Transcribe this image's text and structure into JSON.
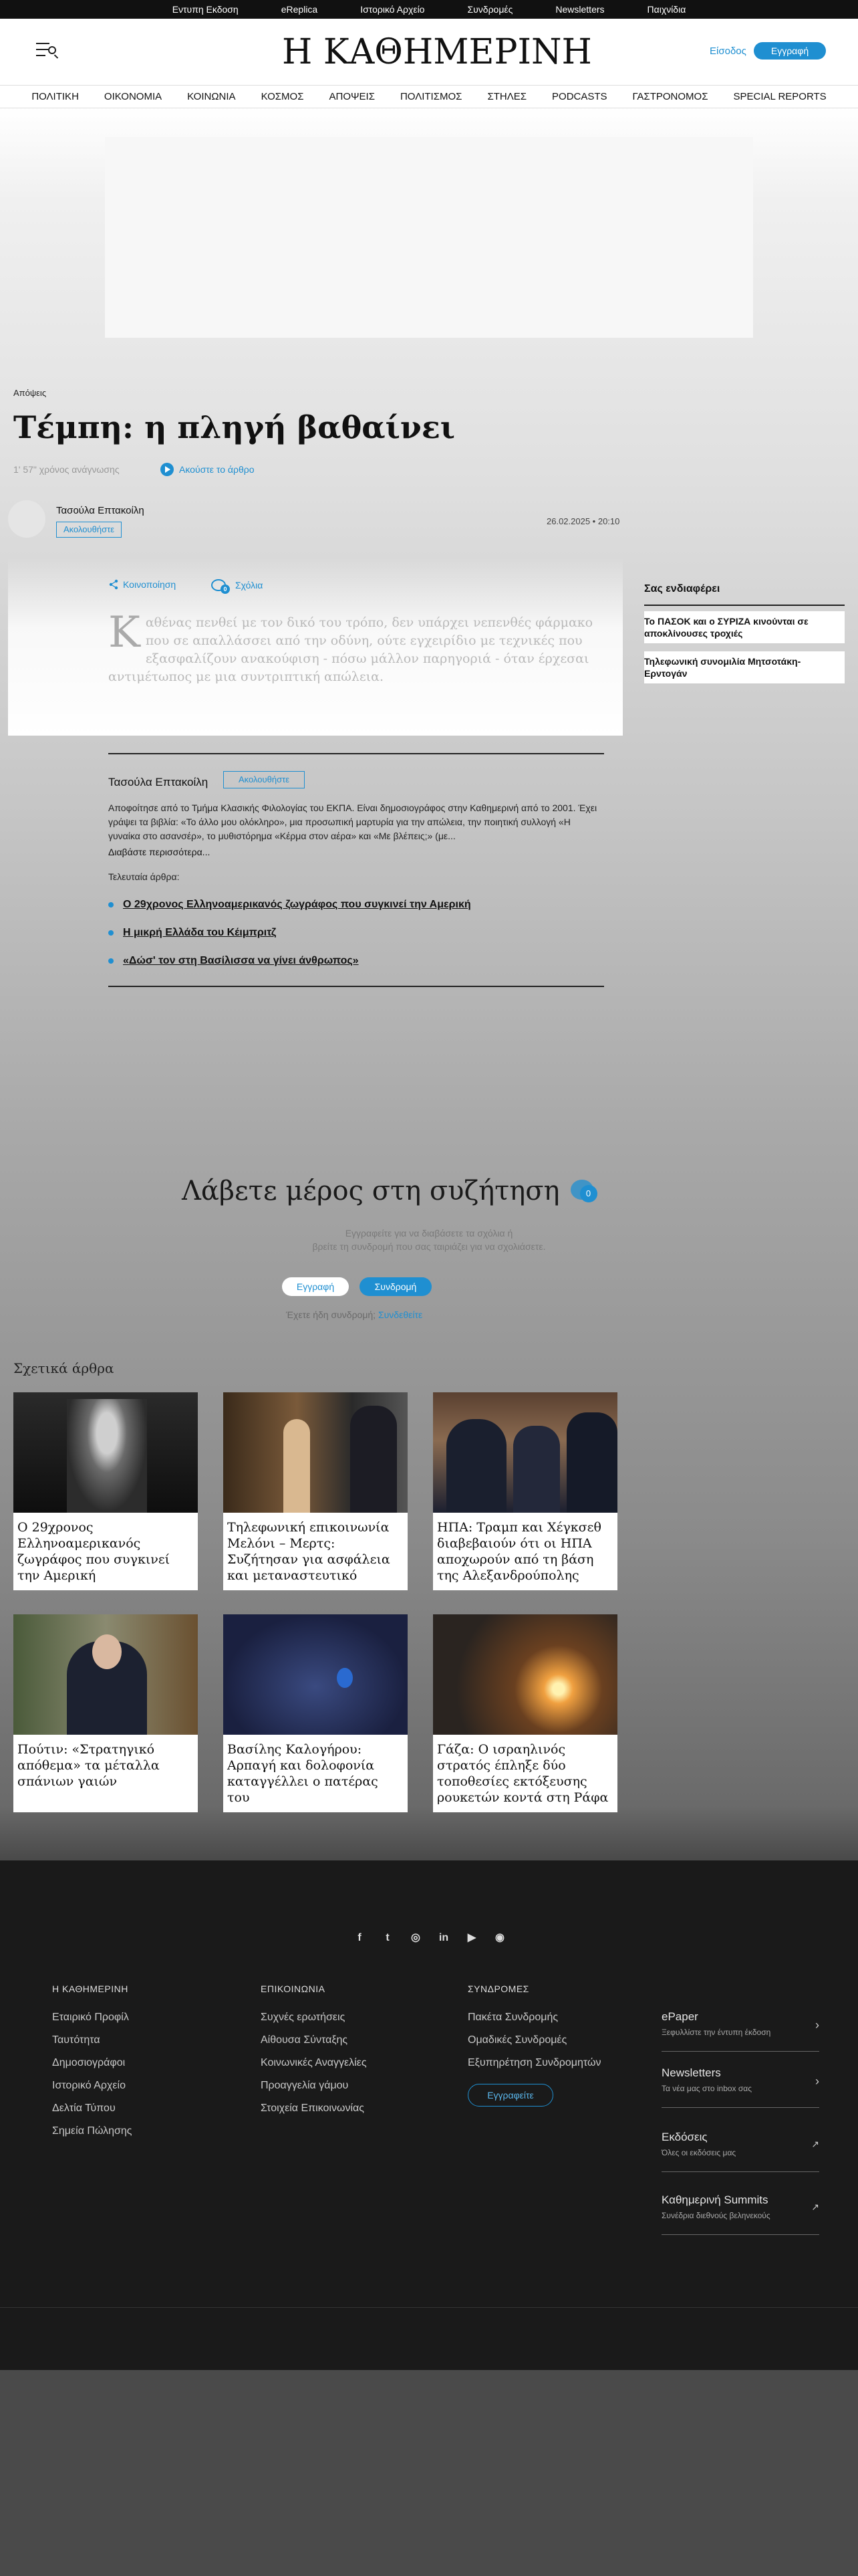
{
  "topbar": [
    "Εντυπη Εκδοση",
    "eReplica",
    "Ιστορικό Αρχείο",
    "Συνδρομές",
    "Newsletters",
    "Παιχνίδια"
  ],
  "header": {
    "logo_text": "Η ΚΑΘΗΜΕΡΙΝΗ",
    "login": "Είσοδος",
    "register": "Εγγραφή",
    "menu_icon": "menu-search-icon",
    "accent": "#1f8fd1"
  },
  "nav": [
    "ΠΟΛΙΤΙΚΗ",
    "ΟΙΚΟΝΟΜΙΑ",
    "ΚΟΙΝΩΝΙΑ",
    "ΚΟΣΜΟΣ",
    "ΑΠΟΨΕΙΣ",
    "ΠΟΛΙΤΙΣΜΟΣ",
    "ΣΤΗΛΕΣ",
    "PODCASTS",
    "ΓΑΣΤΡΟΝΟΜΟΣ",
    "SPECIAL REPORTS"
  ],
  "article": {
    "section": "Απόψεις",
    "title": "Τέμπη: η πληγή βαθαίνει",
    "read_time": "1' 57\" χρόνος ανάγνωσης",
    "listen": "Ακούστε το άρθρο",
    "author": "Τασούλα Επτακοίλη",
    "follow": "Ακολουθήστε",
    "date": "26.02.2025 • 20:10",
    "share": "Κοινοποίηση",
    "comments": "Σχόλια",
    "comment_count": "0",
    "dropcap": "Κ",
    "lead": "αθένας πενθεί με τον δικό του τρόπο, δεν υπάρχει νεπενθές φάρμακο που σε απαλλάσσει από την οδύνη, ούτε εγχειρίδιο με τεχνικές που εξασφαλίζουν ανακούφιση - πόσω μάλλον παρηγοριά - όταν έρχεσαι αντιμέτωπος με μια συντριπτική απώλεια."
  },
  "sidebar": {
    "title": "Σας ενδιαφέρει",
    "items": [
      "Το ΠΑΣΟΚ και ο ΣΥΡΙΖΑ κινούνται σε αποκλίνουσες τροχιές",
      "Τηλεφωνική συνομιλία Μητσοτάκη- Ερντογάν"
    ]
  },
  "author_box": {
    "name": "Τασούλα Επτακοίλη",
    "follow": "Ακολουθήστε",
    "bio": "Αποφοίτησε από το Τμήμα Κλασικής Φιλολογίας του ΕΚΠΑ. Είναι δημοσιογράφος στην Καθημερινή από το 2001. Έχει γράψει τα βιβλία: «Το άλλο μου ολόκληρο», μια προσωπική μαρτυρία για την απώλεια, την ποιητική συλλογή «Η γυναίκα στο ασανσέρ», το μυθιστόρημα «Κέρμα στον αέρα» και «Με βλέπεις;» (με...",
    "more": "Διαβάστε περισσότερα...",
    "latest_label": "Τελευταία άρθρα:",
    "latest": [
      "Ο 29χρονος Ελληνοαμερικανός ζωγράφος που συγκινεί την Αμερική",
      "Η μικρή Ελλάδα του Κέιμπριτζ",
      "«Δώσ' τον στη Βασίλισσα να γίνει άνθρωπος»"
    ]
  },
  "discussion": {
    "title": "Λάβετε μέρος στη συζήτηση",
    "count": "0",
    "line1": "Εγγραφείτε για να διαβάσετε τα σχόλια ή",
    "line2": "βρείτε τη συνδρομή που σας ταιριάζει για να σχολιάσετε.",
    "register": "Εγγραφή",
    "subscribe": "Συνδρομή",
    "have_sub": "Έχετε ήδη συνδρομή;",
    "login": "Συνδεθείτε"
  },
  "related": {
    "title": "Σχετικά άρθρα",
    "cards": [
      "Ο 29χρονος Ελληνοαμερικανός ζωγράφος που συγκινεί την Αμερική",
      "Τηλεφωνική επικοινωνία Μελόνι – Μερτς: Συζήτησαν για ασφάλεια και μεταναστευτικό",
      "ΗΠΑ: Τραμπ και Χέγκσεθ διαβεβαιούν ότι οι ΗΠΑ αποχωρούν από τη βάση της Αλεξανδρούπολης",
      "Πούτιν: «Στρατηγικό απόθεμα» τα μέταλλα σπάνιων γαιών",
      "Βασίλης Καλογήρου: Αρπαγή και δολοφονία καταγγέλλει ο πατέρας του",
      "Γάζα: Ο ισραηλινός στρατός έπληξε δύο τοποθεσίες εκτόξευσης ρουκετών κοντά στη Ράφα"
    ]
  },
  "footer": {
    "socials": [
      "f",
      "t",
      "◎",
      "in",
      "▶",
      "◉"
    ],
    "col1_title": "Η ΚΑΘΗΜΕΡΙΝΗ",
    "col1": [
      "Εταιρικό Προφίλ",
      "Ταυτότητα",
      "Δημοσιογράφοι",
      "Ιστορικό Αρχείο",
      "Δελτία Τύπου",
      "Σημεία Πώλησης"
    ],
    "col2_title": "ΕΠΙΚΟΙΝΩΝΙΑ",
    "col2": [
      "Συχνές ερωτήσεις",
      "Αίθουσα Σύνταξης",
      "Κοινωνικές Αναγγελίες",
      "Προαγγελία γάμου",
      "Στοιχεία Επικοινωνίας"
    ],
    "col3_title": "ΣΥΝΔΡΟΜΕΣ",
    "col3": [
      "Πακέτα Συνδρομής",
      "Ομαδικές Συνδρομές",
      "Εξυπηρέτηση Συνδρομητών"
    ],
    "subscribe": "Εγγραφείτε",
    "side": [
      {
        "title": "ePaper",
        "sub": "Ξεφυλλίστε την έντυπη έκδοση"
      },
      {
        "title": "Newsletters",
        "sub": "Τα νέα μας στο inbox σας"
      },
      {
        "title": "Εκδόσεις",
        "sub": "Όλες οι εκδόσεις μας"
      },
      {
        "title": "Καθημερινή Summits",
        "sub": "Συνέδρια διεθνούς βεληνεκούς"
      }
    ]
  }
}
